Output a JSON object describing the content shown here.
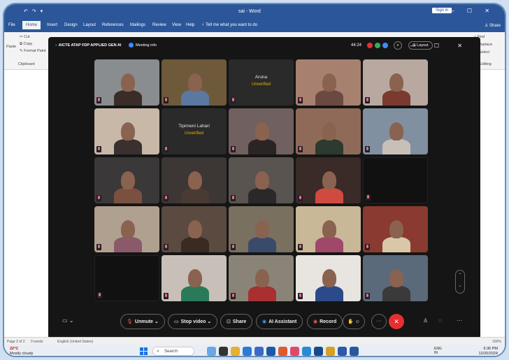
{
  "word": {
    "quick_access": "↶ ↷ ▾",
    "doc_title": "sai - Word",
    "sign_in": "Sign in",
    "tabs": [
      "File",
      "Home",
      "Insert",
      "Design",
      "Layout",
      "References",
      "Mailings",
      "Review",
      "View",
      "Help"
    ],
    "tell_me": "Tell me what you want to do",
    "share": "Share",
    "ribbon": {
      "paste": "Paste",
      "cut": "Cut",
      "copy": "Copy",
      "format_painter": "Format Paint",
      "clipboard": "Clipboard",
      "find": "Find",
      "replace": "Replace",
      "select": "Select",
      "editing": "Editing"
    },
    "status": {
      "page": "Page 2 of 2",
      "words": "0 words",
      "language": "English (United States)",
      "zoom": "100%"
    }
  },
  "taskbar": {
    "temp": "22°C",
    "weather": "Mostly cloudy",
    "search": "Search",
    "lang_top": "ENG",
    "lang_bottom": "IN",
    "time": "6:36 PM",
    "date": "12/20/2024"
  },
  "meeting": {
    "title": "AICTE ATAP FDP APPLIED GEN AI",
    "info": "Meeting info",
    "timer": "44:24",
    "layout": "Layout",
    "tiles": [
      {
        "kind": "video",
        "bg": "#8a8d8f",
        "fg": "#3a2c28"
      },
      {
        "kind": "video",
        "bg": "#6e5a3a",
        "fg": "#5a78a0"
      },
      {
        "kind": "name",
        "name": "Aruna",
        "status": "Unverified"
      },
      {
        "kind": "video",
        "bg": "#a88070",
        "fg": "#6a4a40"
      },
      {
        "kind": "video",
        "bg": "#b8a8a0",
        "fg": "#7a3a30"
      },
      {
        "kind": "video",
        "bg": "#c8b8a8",
        "fg": "#3a3030"
      },
      {
        "kind": "name",
        "name": "Tipirneni Lahari",
        "status": "Unverified"
      },
      {
        "kind": "video",
        "bg": "#706060",
        "fg": "#2a2424"
      },
      {
        "kind": "video",
        "bg": "#906a58",
        "fg": "#2c3a30"
      },
      {
        "kind": "video",
        "bg": "#8090a0",
        "fg": "#c8c0b8"
      },
      {
        "kind": "video",
        "bg": "#3a3838",
        "fg": "#7a5040"
      },
      {
        "kind": "video",
        "bg": "#3c3634",
        "fg": "#4a3a34"
      },
      {
        "kind": "video",
        "bg": "#5a5450",
        "fg": "#2a2828"
      },
      {
        "kind": "video",
        "bg": "#3a2a28",
        "fg": "#d04a40"
      },
      {
        "kind": "black"
      },
      {
        "kind": "video",
        "bg": "#b0a090",
        "fg": "#8a5a6a"
      },
      {
        "kind": "video",
        "bg": "#5a4a40",
        "fg": "#3a2a22"
      },
      {
        "kind": "video",
        "bg": "#7a7060",
        "fg": "#3a4a6a"
      },
      {
        "kind": "video",
        "bg": "#c8b898",
        "fg": "#a0486a"
      },
      {
        "kind": "video",
        "bg": "#8a3a30",
        "fg": "#d8c8a8"
      },
      {
        "kind": "black"
      },
      {
        "kind": "video",
        "bg": "#c8c0b8",
        "fg": "#2a7a5a"
      },
      {
        "kind": "video",
        "bg": "#8a8478",
        "fg": "#a83030"
      },
      {
        "kind": "video",
        "bg": "#e8e4e0",
        "fg": "#2a4a8a"
      },
      {
        "kind": "video",
        "bg": "#5a6a7a",
        "fg": "#3a3a3a"
      }
    ],
    "controls": {
      "unmute": "Unmute",
      "stop_video": "Stop video",
      "share": "Share",
      "ai_assistant": "AI Assistant",
      "record": "Record"
    }
  }
}
